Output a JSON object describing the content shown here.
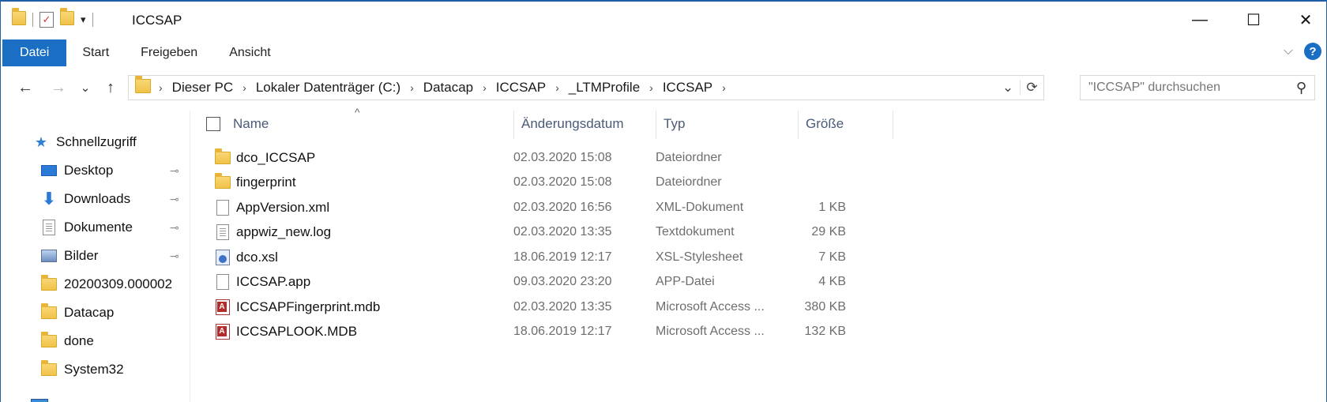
{
  "window": {
    "title": "ICCSAP",
    "minimize_glyph": "—",
    "maximize_glyph": "☐",
    "close_glyph": "✕"
  },
  "ribbon": {
    "tabs": [
      "Datei",
      "Start",
      "Freigeben",
      "Ansicht"
    ],
    "expand_glyph": "⌵",
    "help_glyph": "?"
  },
  "nav_buttons": {
    "back": "←",
    "forward": "→",
    "recent": "⌄",
    "up": "↑"
  },
  "breadcrumb": [
    "Dieser PC",
    "Lokaler Datenträger (C:)",
    "Datacap",
    "ICCSAP",
    "_LTMProfile",
    "ICCSAP"
  ],
  "breadcrumb_sep": "›",
  "address_controls": {
    "dropdown": "⌄",
    "refresh": "⟳"
  },
  "search": {
    "placeholder": "\"ICCSAP\" durchsuchen",
    "icon": "search-icon"
  },
  "navpane": {
    "quick_access": "Schnellzugriff",
    "items": [
      {
        "label": "Desktop",
        "icon": "desktop-icon",
        "pinned": true
      },
      {
        "label": "Downloads",
        "icon": "downloads-icon",
        "pinned": true
      },
      {
        "label": "Dokumente",
        "icon": "documents-icon",
        "pinned": true
      },
      {
        "label": "Bilder",
        "icon": "pictures-icon",
        "pinned": true
      },
      {
        "label": "20200309.000002",
        "icon": "folder-icon",
        "pinned": false
      },
      {
        "label": "Datacap",
        "icon": "folder-icon",
        "pinned": false
      },
      {
        "label": "done",
        "icon": "folder-icon",
        "pinned": false
      },
      {
        "label": "System32",
        "icon": "folder-icon",
        "pinned": false
      }
    ],
    "pin_glyph": "📌"
  },
  "columns": {
    "name": "Name",
    "date": "Änderungsdatum",
    "type": "Typ",
    "size": "Größe"
  },
  "files": [
    {
      "name": "dco_ICCSAP",
      "date": "02.03.2020 15:08",
      "type": "Dateiordner",
      "size": "",
      "icon": "folder"
    },
    {
      "name": "fingerprint",
      "date": "02.03.2020 15:08",
      "type": "Dateiordner",
      "size": "",
      "icon": "folder"
    },
    {
      "name": "AppVersion.xml",
      "date": "02.03.2020 16:56",
      "type": "XML-Dokument",
      "size": "1 KB",
      "icon": "doc"
    },
    {
      "name": "appwiz_new.log",
      "date": "02.03.2020 13:35",
      "type": "Textdokument",
      "size": "29 KB",
      "icon": "text"
    },
    {
      "name": "dco.xsl",
      "date": "18.06.2019 12:17",
      "type": "XSL-Stylesheet",
      "size": "7 KB",
      "icon": "xsl"
    },
    {
      "name": "ICCSAP.app",
      "date": "09.03.2020 23:20",
      "type": "APP-Datei",
      "size": "4 KB",
      "icon": "doc"
    },
    {
      "name": "ICCSAPFingerprint.mdb",
      "date": "02.03.2020 13:35",
      "type": "Microsoft Access ...",
      "size": "380 KB",
      "icon": "access"
    },
    {
      "name": "ICCSAPLOOK.MDB",
      "date": "18.06.2019 12:17",
      "type": "Microsoft Access ...",
      "size": "132 KB",
      "icon": "access"
    }
  ],
  "colors": {
    "accent": "#1a6fc4",
    "folder": "#f0c24a",
    "header_text": "#4a5a78"
  }
}
